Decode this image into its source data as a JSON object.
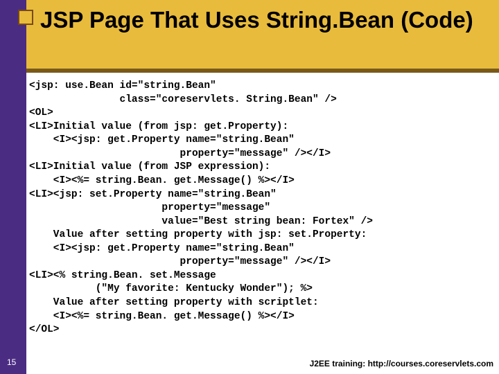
{
  "slide": {
    "title": "JSP Page That Uses String.Bean (Code)",
    "pageNumber": "15",
    "footer": "J2EE training: http://courses.coreservlets.com"
  },
  "code": {
    "lines": [
      "<jsp: use.Bean id=\"string.Bean\"",
      "               class=\"coreservlets. String.Bean\" />",
      "<OL>",
      "<LI>Initial value (from jsp: get.Property):",
      "    <I><jsp: get.Property name=\"string.Bean\"",
      "                         property=\"message\" /></I>",
      "<LI>Initial value (from JSP expression):",
      "    <I><%= string.Bean. get.Message() %></I>",
      "<LI><jsp: set.Property name=\"string.Bean\"",
      "                      property=\"message\"",
      "                      value=\"Best string bean: Fortex\" />",
      "    Value after setting property with jsp: set.Property:",
      "    <I><jsp: get.Property name=\"string.Bean\"",
      "                         property=\"message\" /></I>",
      "<LI><% string.Bean. set.Message",
      "           (\"My favorite: Kentucky Wonder\"); %>",
      "    Value after setting property with scriptlet:",
      "    <I><%= string.Bean. get.Message() %></I>",
      "</OL>"
    ]
  }
}
